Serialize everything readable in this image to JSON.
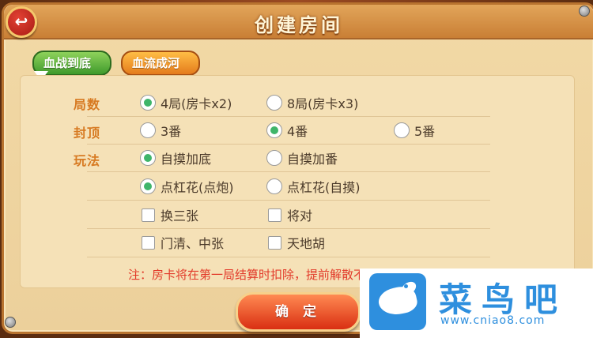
{
  "dialog": {
    "title": "创建房间",
    "back_icon": "back-arrow-icon"
  },
  "tabs": [
    {
      "label": "血战到底",
      "active": true
    },
    {
      "label": "血流成河",
      "active": false
    }
  ],
  "sections": {
    "rounds": {
      "label": "局数",
      "options": [
        {
          "text": "4局(房卡x2)",
          "selected": true
        },
        {
          "text": "8局(房卡x3)",
          "selected": false
        }
      ]
    },
    "cap": {
      "label": "封顶",
      "options": [
        {
          "text": "3番",
          "selected": false
        },
        {
          "text": "4番",
          "selected": true
        },
        {
          "text": "5番",
          "selected": false
        }
      ]
    },
    "play": {
      "label": "玩法",
      "self_draw": [
        {
          "text": "自摸加底",
          "selected": true
        },
        {
          "text": "自摸加番",
          "selected": false
        }
      ],
      "kong": [
        {
          "text": "点杠花(点炮)",
          "selected": true
        },
        {
          "text": "点杠花(自摸)",
          "selected": false
        }
      ],
      "extras": [
        {
          "text": "换三张",
          "checked": false
        },
        {
          "text": "将对",
          "checked": false
        },
        {
          "text": "门清、中张",
          "checked": false
        },
        {
          "text": "天地胡",
          "checked": false
        }
      ]
    }
  },
  "note": "注：房卡将在第一局结算时扣除，提前解散不扣房卡",
  "confirm_label": "确 定",
  "watermark": {
    "name": "菜鸟吧",
    "url": "www.cniao8.com"
  },
  "colors": {
    "label": "#d77a22",
    "radio_selected": "#3fb56a",
    "note": "#e23a2a",
    "active_tab": "#5cb33c",
    "inactive_tab": "#f2a030"
  }
}
